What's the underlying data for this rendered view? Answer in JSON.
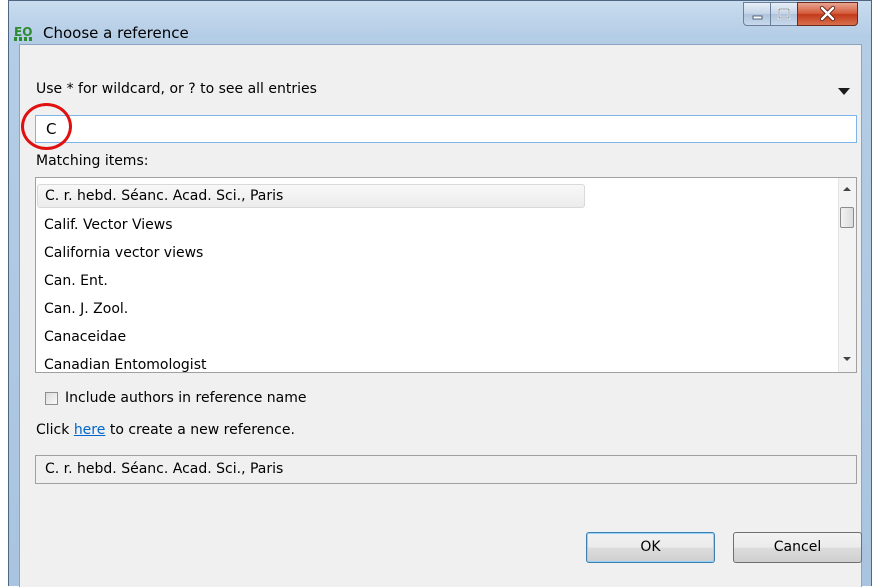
{
  "window": {
    "title": "Choose a reference",
    "icon": "app-logo-icon"
  },
  "title_buttons": {
    "minimize": "minimize-icon",
    "maximize": "maximize-icon",
    "close": "close-icon"
  },
  "search": {
    "hint": "Use * for wildcard, or ? to see all entries",
    "value": "C"
  },
  "matching": {
    "label": "Matching items:",
    "items": [
      "C. r. hebd. Séanc. Acad. Sci., Paris",
      "Calif. Vector Views",
      "California vector views",
      "Can. Ent.",
      "Can. J. Zool.",
      "Canaceidae",
      "Canadian Entomologist"
    ],
    "selected_index": 0
  },
  "include_authors": {
    "label": "Include authors in reference name",
    "checked": false
  },
  "create": {
    "prefix": "Click ",
    "link": "here",
    "suffix": " to create a new reference."
  },
  "selected_value": "C. r. hebd. Séanc. Acad. Sci., Paris",
  "buttons": {
    "ok": "OK",
    "cancel": "Cancel"
  },
  "colors": {
    "highlight_ring": "#e01010",
    "link": "#0066cc"
  }
}
